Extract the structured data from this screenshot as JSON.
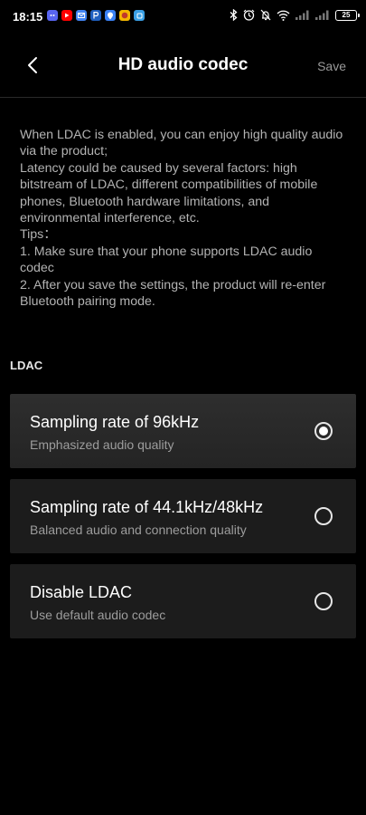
{
  "status_bar": {
    "time": "18:15",
    "battery": "25",
    "notification_icons": [
      "discord-icon",
      "youtube-icon",
      "mail-icon",
      "paypal-icon",
      "maps-icon",
      "game-icon",
      "app-icon"
    ],
    "system_icons": [
      "bluetooth-icon",
      "alarm-icon",
      "dnd-bell-off-icon",
      "wifi-icon",
      "signal-icon",
      "battery-icon"
    ]
  },
  "header": {
    "title": "HD audio codec",
    "save_label": "Save"
  },
  "description": {
    "lines": [
      "When LDAC is enabled, you can enjoy high quality audio via the product;",
      "Latency could be caused by several factors: high bitstream of LDAC, different compatibilities of mobile phones, Bluetooth hardware limitations, and environmental interference, etc.",
      "Tips：",
      "1. Make sure that your phone supports LDAC audio codec",
      "2. After you save the settings, the product will re-enter Bluetooth pairing mode."
    ]
  },
  "section": {
    "label": "LDAC"
  },
  "options": [
    {
      "title": "Sampling rate of 96kHz",
      "subtitle": "Emphasized audio quality",
      "selected": true
    },
    {
      "title": "Sampling rate of 44.1kHz/48kHz",
      "subtitle": "Balanced audio and connection quality",
      "selected": false
    },
    {
      "title": "Disable LDAC",
      "subtitle": "Use default audio codec",
      "selected": false
    }
  ],
  "colors": {
    "background": "#000000",
    "card": "#1c1c1c",
    "card_selected": "#2a2a2a",
    "text_primary": "#ffffff",
    "text_secondary": "#9d9d9d"
  }
}
